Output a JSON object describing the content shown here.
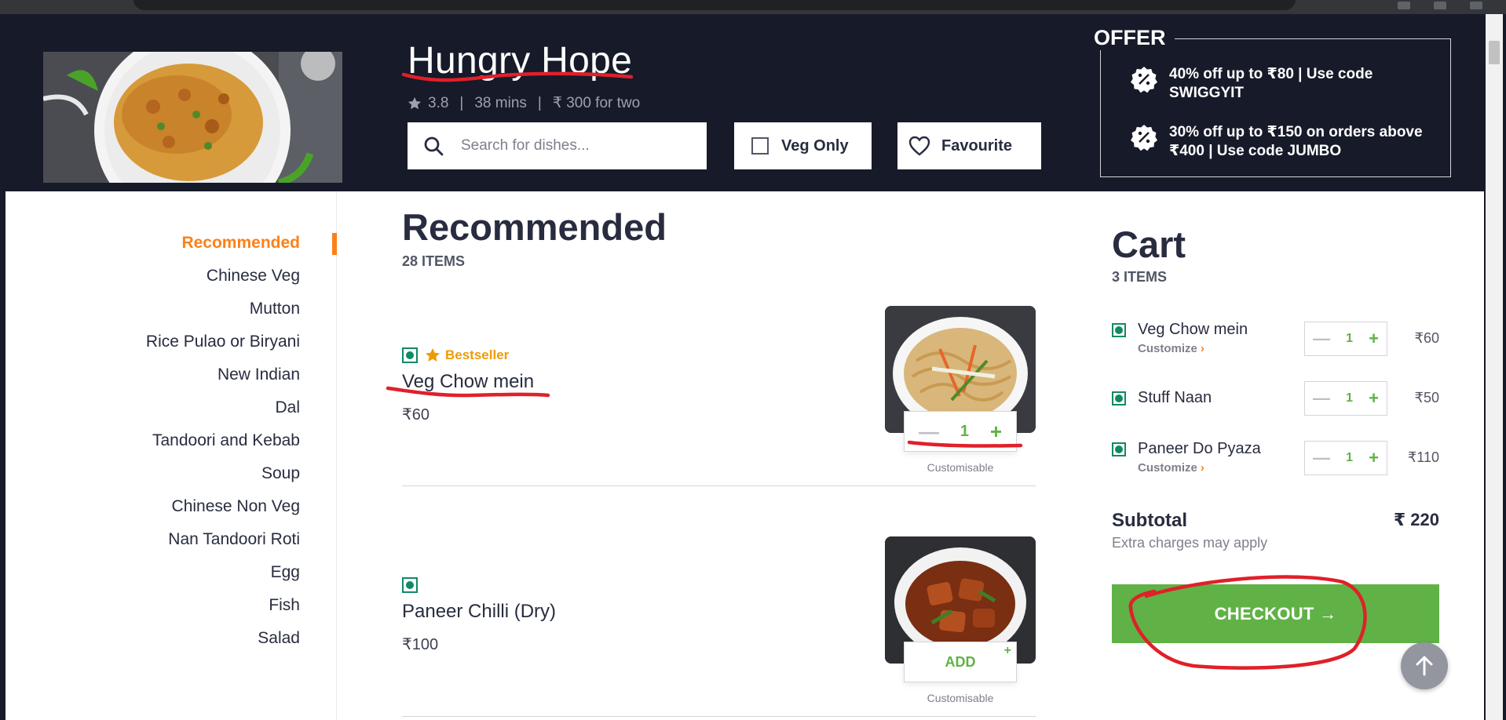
{
  "browser": {
    "url_fragment": ""
  },
  "restaurant": {
    "name": "Hungry Hope",
    "rating": "3.8",
    "delivery_time": "38 mins",
    "cost_for_two": "₹ 300 for two"
  },
  "search": {
    "placeholder": "Search for dishes..."
  },
  "filters": {
    "veg_only_label": "Veg Only",
    "veg_only_checked": false,
    "favourite_label": "Favourite"
  },
  "offer": {
    "title": "OFFER",
    "items": [
      {
        "text": "40% off up to ₹80 | Use code SWIGGYIT",
        "icon": "discount-badge-icon"
      },
      {
        "text": "30% off up to ₹150 on orders above ₹400 | Use code JUMBO",
        "icon": "discount-badge-icon"
      }
    ]
  },
  "nav": {
    "items": [
      {
        "label": "Recommended",
        "active": true
      },
      {
        "label": "Chinese Veg"
      },
      {
        "label": "Mutton"
      },
      {
        "label": "Rice Pulao or Biryani"
      },
      {
        "label": "New Indian"
      },
      {
        "label": "Dal"
      },
      {
        "label": "Tandoori and Kebab"
      },
      {
        "label": "Soup"
      },
      {
        "label": "Chinese Non Veg"
      },
      {
        "label": "Nan Tandoori Roti"
      },
      {
        "label": "Egg"
      },
      {
        "label": "Fish"
      },
      {
        "label": "Salad"
      }
    ]
  },
  "menu": {
    "section_title": "Recommended",
    "section_count": "28 ITEMS",
    "dishes": [
      {
        "badge": "Bestseller",
        "name": "Veg Chow mein",
        "price": "₹60",
        "quantity": "1",
        "minus": "—",
        "plus": "+",
        "customisable": "Customisable"
      },
      {
        "name": "Paneer Chilli (Dry)",
        "price": "₹100",
        "add_label": "ADD",
        "add_plus": "+",
        "customisable": "Customisable"
      }
    ]
  },
  "cart": {
    "title": "Cart",
    "count": "3 ITEMS",
    "items": [
      {
        "name": "Veg Chow mein",
        "customize": "Customize",
        "quantity": "1",
        "price": "₹60",
        "minus": "—",
        "plus": "+"
      },
      {
        "name": "Stuff Naan",
        "quantity": "1",
        "price": "₹50",
        "minus": "—",
        "plus": "+"
      },
      {
        "name": "Paneer Do Pyaza",
        "customize": "Customize",
        "quantity": "1",
        "price": "₹110",
        "minus": "—",
        "plus": "+"
      }
    ],
    "subtotal_label": "Subtotal",
    "subtotal_value": "₹ 220",
    "extra_charges": "Extra charges may apply",
    "checkout_label": "CHECKOUT →"
  },
  "colors": {
    "header_bg": "#171a29",
    "accent_orange": "#fc8019",
    "accent_green": "#60b246",
    "veg_green": "#0f8a65",
    "bestseller": "#ee9c00",
    "annotation_red": "#e0202a"
  }
}
